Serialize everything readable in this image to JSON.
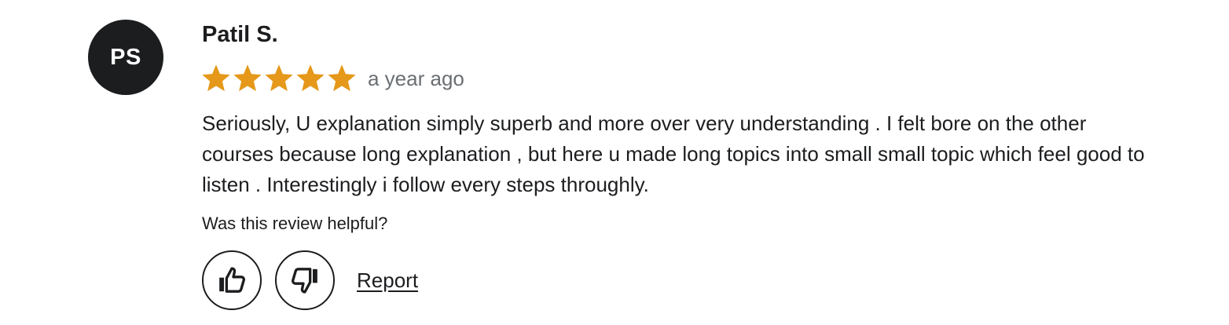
{
  "review": {
    "avatar_initials": "PS",
    "reviewer_name": "Patil S.",
    "rating": 5,
    "rating_max": 5,
    "time_ago": "a year ago",
    "text": "Seriously, U explanation simply superb and more over very understanding . I felt bore on the other courses because long explanation , but here u made long topics into small small topic which feel good to listen . Interestingly i follow every steps throughly.",
    "helpful_prompt": "Was this review helpful?",
    "report_label": "Report"
  },
  "icons": {
    "star": "star-icon",
    "thumbs_up": "thumbs-up-icon",
    "thumbs_down": "thumbs-down-icon"
  },
  "colors": {
    "avatar_bg": "#1c1d1f",
    "star": "#e59819",
    "text": "#1c1d1f",
    "muted": "#6a6f73"
  }
}
